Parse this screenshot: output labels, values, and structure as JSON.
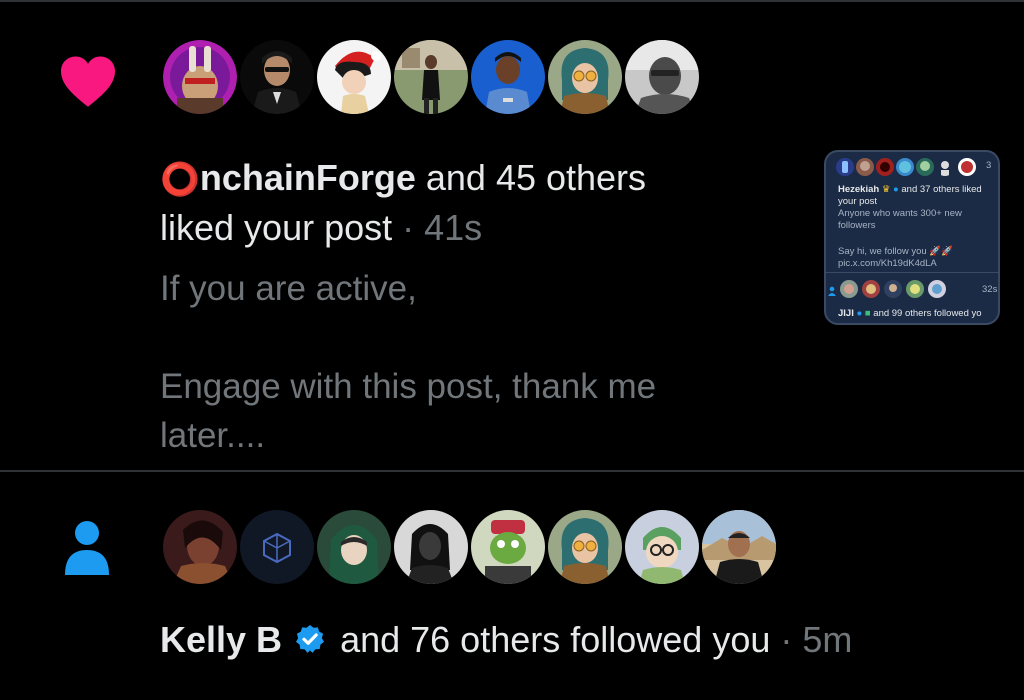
{
  "colors": {
    "accent_like": "#f91880",
    "accent_follow": "#1d9bf0",
    "muted": "#71767b",
    "text": "#e7e9ea"
  },
  "notification_like": {
    "icon": "heart-icon",
    "logo_glyph": "⭕",
    "actor_rest": "nchainForge",
    "others": " and 45 others",
    "action": "liked your post",
    "separator": " · ",
    "time": "41s",
    "post_text": "If you are active,\n\nEngage with this post, thank me\nlater....",
    "avatars": [
      "avatar-1",
      "avatar-2",
      "avatar-3",
      "avatar-4",
      "avatar-5",
      "avatar-6",
      "avatar-7"
    ],
    "thumbnail": {
      "time_partial": "3",
      "actor": "Hezekiah",
      "others": " and 37 others liked",
      "line2": "your post",
      "post_line1": "Anyone who wants 300+ new",
      "post_line2": "followers",
      "post_line3": "Say hi, we follow you 🚀🚀",
      "post_line4": "pic.x.com/Kh19dK4dLA",
      "time2": "32s",
      "follow_actor": "JIJI",
      "follow_text": " and 99 others followed yo"
    }
  },
  "notification_follow": {
    "icon": "person-icon",
    "actor": "Kelly B",
    "others": " and 76 others followed you",
    "separator": " · ",
    "time": "5m",
    "avatars": [
      "avatar-1",
      "avatar-2",
      "avatar-3",
      "avatar-4",
      "avatar-5",
      "avatar-6",
      "avatar-7",
      "avatar-8"
    ]
  }
}
